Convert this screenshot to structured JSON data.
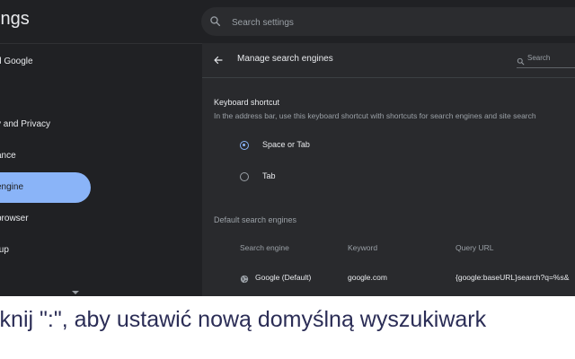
{
  "app": {
    "title": "ings"
  },
  "search": {
    "placeholder": "Search settings",
    "icon": "search-icon"
  },
  "sidebar": {
    "items": [
      {
        "label": "d Google"
      },
      {
        "label": ""
      },
      {
        "label": "y and Privacy"
      },
      {
        "label": "ance"
      },
      {
        "label": "engine",
        "active": true
      },
      {
        "label": " browser"
      },
      {
        "label": "tup"
      }
    ]
  },
  "panel": {
    "title": "Manage search engines",
    "search_label": "Search",
    "keyboard_shortcut": {
      "title": "Keyboard shortcut",
      "description": "In the address bar, use this keyboard shortcut with shortcuts for search engines and site search",
      "options": [
        {
          "label": "Space or Tab",
          "selected": true
        },
        {
          "label": "Tab",
          "selected": false
        }
      ]
    },
    "default_engines": {
      "title": "Default search engines",
      "columns": [
        "Search engine",
        "Keyword",
        "Query URL"
      ],
      "rows": [
        {
          "engine": "Google (Default)",
          "keyword": "google.com",
          "url": "{google:baseURL}search?q=%s&"
        }
      ]
    }
  },
  "caption": "iknij \":\", aby ustawić nową domyślną wyszukiwark",
  "colors": {
    "background": "#202124",
    "card": "#292a2d",
    "accent": "#8ab4f8",
    "caption": "#2b2d56"
  }
}
